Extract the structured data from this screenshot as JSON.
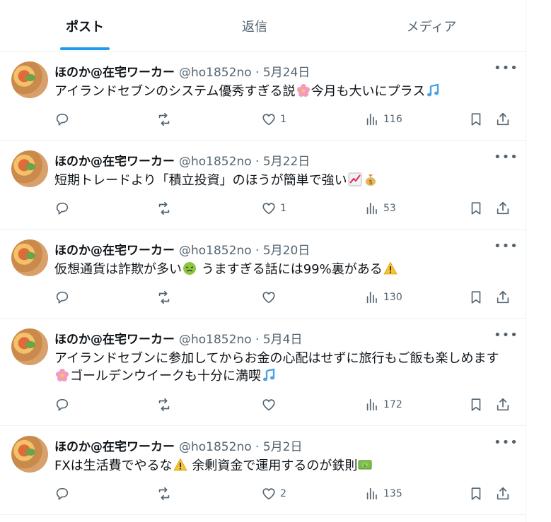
{
  "tabs": [
    {
      "label": "ポスト",
      "active": true
    },
    {
      "label": "返信",
      "active": false
    },
    {
      "label": "メディア",
      "active": false
    }
  ],
  "author": {
    "name": "ほのか@在宅ワーカー",
    "handle": "@ho1852no"
  },
  "more_icon": "more-horizontal-icon",
  "posts": [
    {
      "date": "5月24日",
      "meta": "@ho1852no · 5月24日",
      "text_parts": [
        "アイランドセブンのシステム優秀すぎる説",
        "cherry-blossom",
        "今月も大いにプラス",
        "music-note"
      ],
      "reply": "",
      "repost": "",
      "like": "1",
      "views": "116"
    },
    {
      "date": "5月22日",
      "meta": "@ho1852no · 5月22日",
      "text_parts": [
        "短期トレードより「積立投資」のほうが簡単で強い",
        "chart-up",
        "money-bag"
      ],
      "reply": "",
      "repost": "",
      "like": "1",
      "views": "53"
    },
    {
      "date": "5月20日",
      "meta": "@ho1852no · 5月20日",
      "text_parts": [
        "仮想通貨は詐欺が多い",
        "nauseated-face",
        " うますぎる話には99%裏がある",
        "warning"
      ],
      "reply": "",
      "repost": "",
      "like": "",
      "views": "130"
    },
    {
      "date": "5月4日",
      "meta": "@ho1852no · 5月4日",
      "text_parts": [
        "アイランドセブンに参加してからお金の心配はせずに旅行もご飯も楽しめます",
        "cherry-blossom",
        "ゴールデンウイークも十分に満喫",
        "music-note"
      ],
      "reply": "",
      "repost": "",
      "like": "",
      "views": "172"
    },
    {
      "date": "5月2日",
      "meta": "@ho1852no · 5月2日",
      "text_parts": [
        "FXは生活費でやるな",
        "warning",
        " 余剰資金で運用するのが鉄則",
        "dollar-banknote"
      ],
      "reply": "",
      "repost": "",
      "like": "2",
      "views": "135"
    }
  ],
  "icons": {
    "reply": "reply-icon",
    "repost": "repost-icon",
    "like": "heart-icon",
    "views": "views-chart-icon",
    "bookmark": "bookmark-icon",
    "share": "share-icon"
  },
  "colors": {
    "accent": "#1d9bf0",
    "text": "#0f1419",
    "muted": "#536471",
    "divider": "#eff3f4"
  }
}
